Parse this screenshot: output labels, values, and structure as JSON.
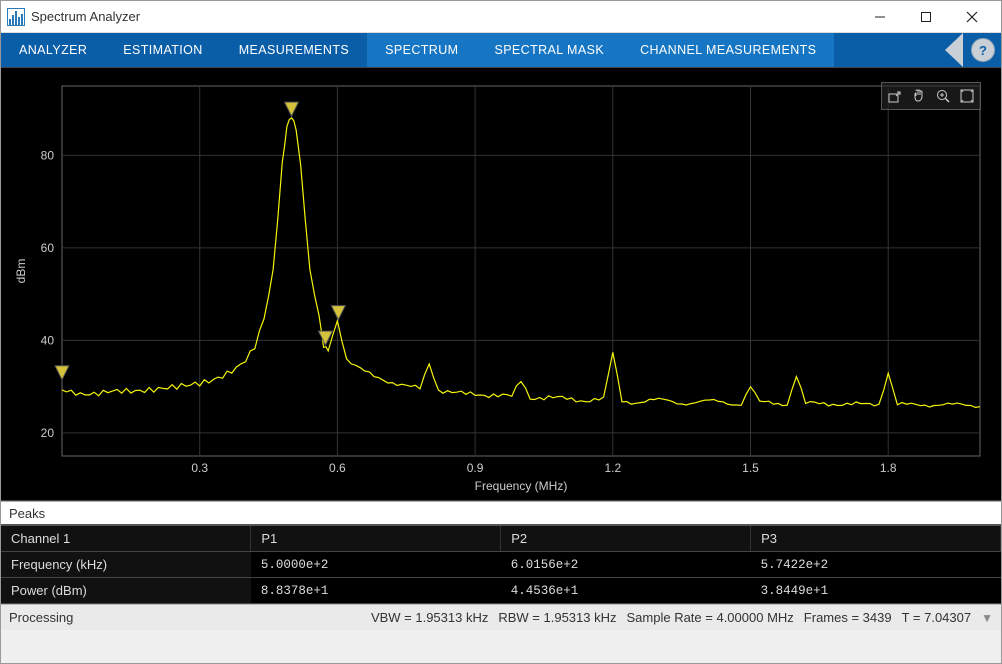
{
  "window": {
    "title": "Spectrum Analyzer"
  },
  "toolstrip": {
    "tabs_primary": [
      "ANALYZER",
      "ESTIMATION",
      "MEASUREMENTS"
    ],
    "tabs_secondary": [
      "SPECTRUM",
      "SPECTRAL MASK",
      "CHANNEL MEASUREMENTS"
    ]
  },
  "chart_data": {
    "type": "line",
    "title": "",
    "xlabel": "Frequency (MHz)",
    "ylabel": "dBm",
    "xlim": [
      0,
      2.0
    ],
    "ylim": [
      15,
      95
    ],
    "xticks": [
      0.3,
      0.6,
      0.9,
      1.2,
      1.5,
      1.8
    ],
    "yticks": [
      20,
      40,
      60,
      80
    ],
    "series": [
      {
        "name": "Channel 1",
        "color": "#f5f50a",
        "x": [
          0.0,
          0.02,
          0.04,
          0.06,
          0.08,
          0.1,
          0.12,
          0.14,
          0.16,
          0.18,
          0.2,
          0.22,
          0.24,
          0.26,
          0.28,
          0.3,
          0.32,
          0.34,
          0.36,
          0.38,
          0.4,
          0.42,
          0.44,
          0.46,
          0.48,
          0.49,
          0.5,
          0.51,
          0.52,
          0.54,
          0.56,
          0.57,
          0.58,
          0.6,
          0.62,
          0.64,
          0.66,
          0.68,
          0.7,
          0.72,
          0.74,
          0.76,
          0.78,
          0.8,
          0.82,
          0.84,
          0.86,
          0.88,
          0.9,
          0.92,
          0.94,
          0.96,
          0.98,
          1.0,
          1.02,
          1.04,
          1.06,
          1.08,
          1.1,
          1.12,
          1.14,
          1.16,
          1.18,
          1.2,
          1.22,
          1.24,
          1.26,
          1.28,
          1.3,
          1.32,
          1.34,
          1.36,
          1.38,
          1.4,
          1.42,
          1.44,
          1.46,
          1.48,
          1.5,
          1.52,
          1.54,
          1.56,
          1.58,
          1.6,
          1.62,
          1.64,
          1.66,
          1.68,
          1.7,
          1.72,
          1.74,
          1.76,
          1.78,
          1.8,
          1.82,
          1.84,
          1.86,
          1.88,
          1.9,
          1.92,
          1.94,
          1.96,
          1.98,
          2.0
        ],
        "y": [
          29.0,
          28.7,
          28.5,
          28.6,
          28.6,
          28.8,
          28.9,
          29.0,
          29.1,
          29.3,
          29.4,
          29.6,
          29.8,
          30.1,
          30.4,
          30.8,
          31.3,
          31.9,
          32.7,
          33.8,
          35.6,
          38.8,
          45.0,
          55.0,
          78.0,
          86.0,
          88.4,
          86.0,
          78.0,
          55.0,
          45.0,
          38.4,
          38.0,
          44.5,
          36.0,
          34.4,
          33.2,
          32.2,
          31.5,
          30.9,
          30.4,
          30.0,
          29.6,
          35.0,
          29.2,
          28.9,
          28.7,
          28.5,
          28.4,
          28.2,
          28.1,
          28.0,
          27.9,
          31.5,
          27.7,
          27.6,
          27.5,
          27.4,
          27.4,
          27.3,
          27.2,
          27.2,
          27.1,
          37.0,
          27.0,
          26.9,
          26.9,
          26.9,
          26.8,
          26.8,
          26.7,
          26.7,
          26.7,
          26.6,
          26.6,
          26.6,
          26.5,
          26.5,
          30.0,
          26.4,
          26.4,
          26.4,
          26.4,
          32.5,
          26.3,
          26.3,
          26.3,
          26.3,
          26.2,
          26.2,
          26.2,
          26.2,
          26.2,
          33.0,
          26.1,
          26.1,
          26.1,
          26.1,
          26.1,
          26.1,
          26.0,
          26.0,
          26.0,
          26.0
        ]
      }
    ],
    "markers": [
      {
        "x": 0.0,
        "y": 33.0,
        "label": ""
      },
      {
        "x": 0.5,
        "y": 90.0,
        "label": ""
      },
      {
        "x": 0.574,
        "y": 40.5,
        "label": ""
      },
      {
        "x": 0.602,
        "y": 46.0,
        "label": ""
      }
    ]
  },
  "peaks": {
    "header": "Peaks",
    "channel_label": "Channel 1",
    "columns": [
      "P1",
      "P2",
      "P3"
    ],
    "rows": [
      {
        "label": "Frequency (kHz)",
        "values": [
          "5.0000e+2",
          "6.0156e+2",
          "5.7422e+2"
        ]
      },
      {
        "label": "Power (dBm)",
        "values": [
          "8.8378e+1",
          "4.4536e+1",
          "3.8449e+1"
        ]
      }
    ]
  },
  "status": {
    "left": "Processing",
    "vbw": "VBW = 1.95313 kHz",
    "rbw": "RBW = 1.95313 kHz",
    "sample_rate": "Sample Rate = 4.00000 MHz",
    "frames": "Frames = 3439",
    "time": "T = 7.04307"
  }
}
